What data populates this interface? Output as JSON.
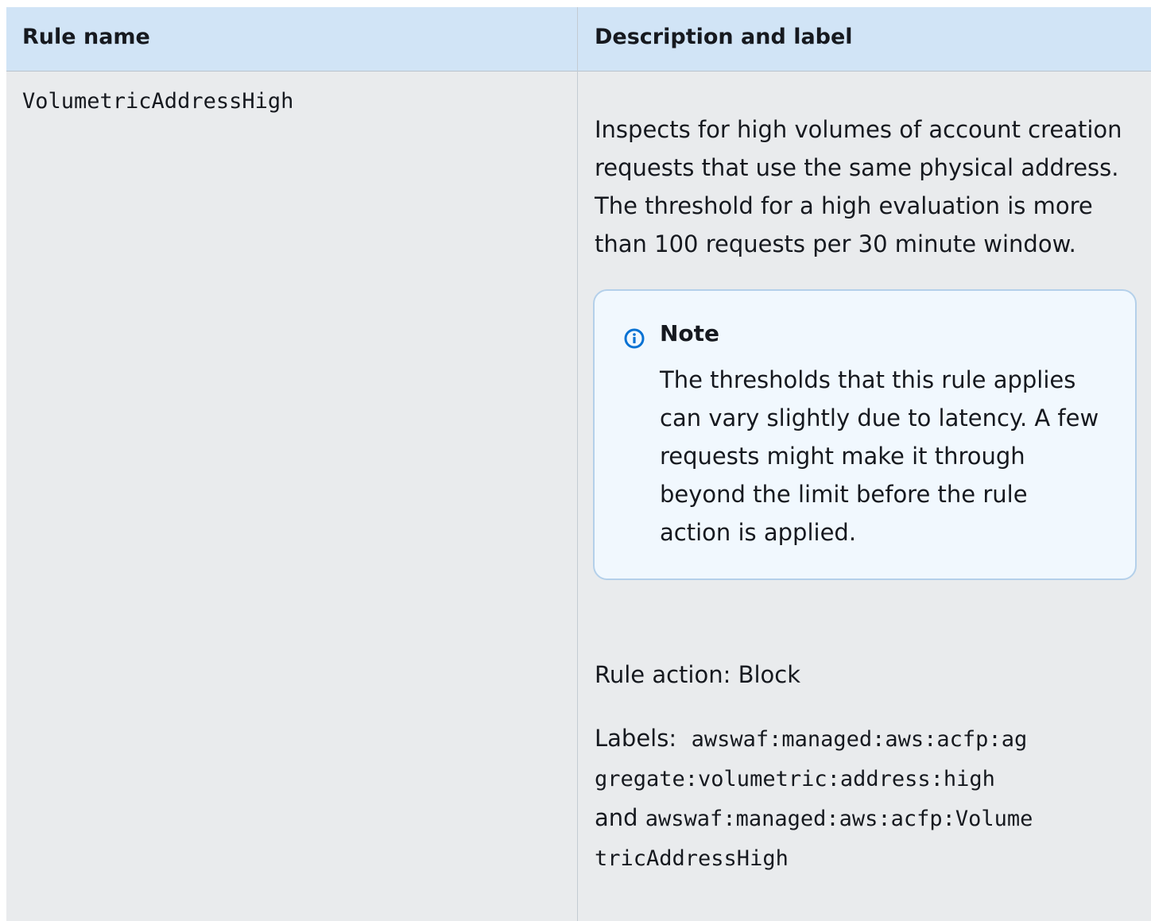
{
  "table": {
    "headers": [
      "Rule name",
      "Description and label"
    ],
    "row": {
      "rule_name": "VolumetricAddressHigh",
      "description": "Inspects for high volumes of account creation requests that use the same physical address. The threshold for a high evaluation is more than 100 requests per 30 minute window.",
      "note": {
        "icon": "info-icon",
        "title": "Note",
        "body": "The thresholds that this rule applies can vary slightly due to latency. A few requests might make it through beyond the limit before the rule action is applied."
      },
      "rule_action": "Rule action: Block",
      "labels": {
        "prefix": "Labels:",
        "label_1": "awswaf:managed:aws:acfp:aggregate:volumetric:address:high",
        "joiner": "and",
        "label_2": "awswaf:managed:aws:acfp:VolumetricAddressHigh"
      }
    }
  },
  "colors": {
    "header_bg": "#d1e4f6",
    "body_bg": "#e9ebed",
    "note_bg": "#f1f8fe",
    "note_border": "#b4d0ea",
    "info_icon": "#0972d3"
  }
}
